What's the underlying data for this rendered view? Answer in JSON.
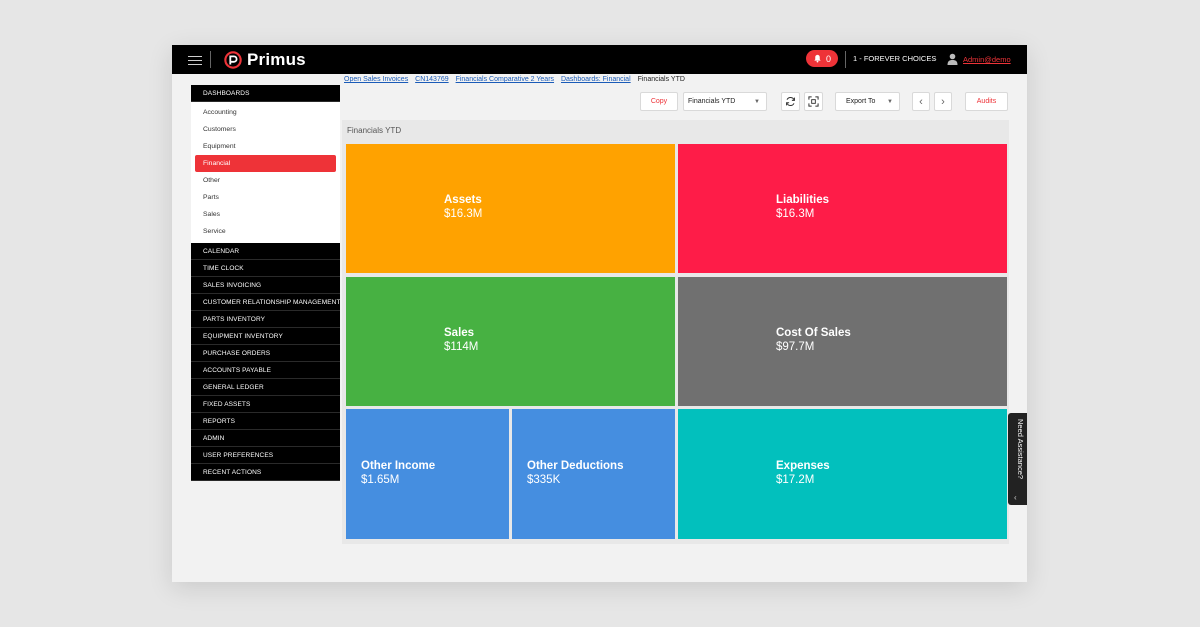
{
  "topbar": {
    "brand": "Primus",
    "notifications": "0",
    "company": "1 - FOREVER CHOICES",
    "user": "Admin@demo"
  },
  "breadcrumb": {
    "links": [
      "Open Sales Invoices",
      "CN143769",
      "Financials Comparative 2 Years",
      "Dashboards: Financial"
    ],
    "current": "Financials YTD"
  },
  "sidebar": {
    "dashboards_label": "DASHBOARDS",
    "dashboard_items": [
      "Accounting",
      "Customers",
      "Equipment",
      "Financial",
      "Other",
      "Parts",
      "Sales",
      "Service"
    ],
    "active_item": "Financial",
    "sections": [
      "CALENDAR",
      "TIME CLOCK",
      "SALES INVOICING",
      "CUSTOMER RELATIONSHIP MANAGEMENT",
      "PARTS INVENTORY",
      "EQUIPMENT INVENTORY",
      "PURCHASE ORDERS",
      "ACCOUNTS PAYABLE",
      "GENERAL LEDGER",
      "FIXED ASSETS",
      "REPORTS",
      "ADMIN",
      "USER PREFERENCES",
      "RECENT ACTIONS"
    ]
  },
  "toolbar": {
    "copy": "Copy",
    "selected_dashboard": "Financials YTD",
    "export": "Export To",
    "audits": "Audits"
  },
  "panel": {
    "title": "Financials YTD",
    "tiles": [
      {
        "label": "Assets",
        "value": "$16.3M",
        "color": "#ffa200"
      },
      {
        "label": "Liabilities",
        "value": "$16.3M",
        "color": "#fe1c48"
      },
      {
        "label": "Sales",
        "value": "$114M",
        "color": "#47b142"
      },
      {
        "label": "Cost Of Sales",
        "value": "$97.7M",
        "color": "#707070"
      },
      {
        "label": "Other Income",
        "value": "$1.65M",
        "color": "#458ee0"
      },
      {
        "label": "Other Deductions",
        "value": "$335K",
        "color": "#458ee0"
      },
      {
        "label": "Expenses",
        "value": "$17.2M",
        "color": "#02c0bd"
      }
    ]
  },
  "assist": {
    "label": "Need Assistance?"
  },
  "colors": {
    "accent": "#ee3338",
    "topbar": "#000000",
    "link": "#1a5bb8"
  }
}
